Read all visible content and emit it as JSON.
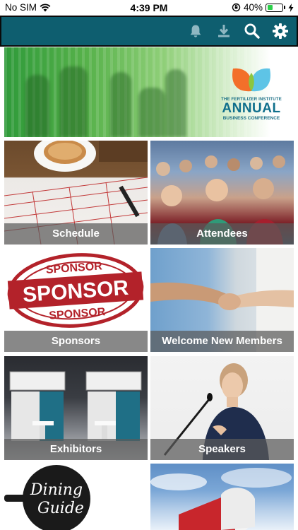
{
  "status": {
    "carrier": "No SIM",
    "time": "4:39 PM",
    "battery_percent": "40%",
    "battery_level": 0.4
  },
  "header": {
    "icons": [
      "bell-icon",
      "download-icon",
      "search-icon",
      "gear-icon"
    ],
    "background_color": "#0e5e6f"
  },
  "banner": {
    "logo_small": "THE FERTILIZER INSTITUTE",
    "logo_big": "ANNUAL",
    "logo_sub": "BUSINESS CONFERENCE"
  },
  "tiles": [
    {
      "label": "Schedule"
    },
    {
      "label": "Attendees"
    },
    {
      "label": "Sponsors"
    },
    {
      "label": "Welcome New Members"
    },
    {
      "label": "Exhibitors"
    },
    {
      "label": "Speakers"
    }
  ],
  "sponsor_stamp": {
    "word": "SPONSOR"
  },
  "dining_logo": {
    "line1": "Dining",
    "line2": "Guide"
  }
}
